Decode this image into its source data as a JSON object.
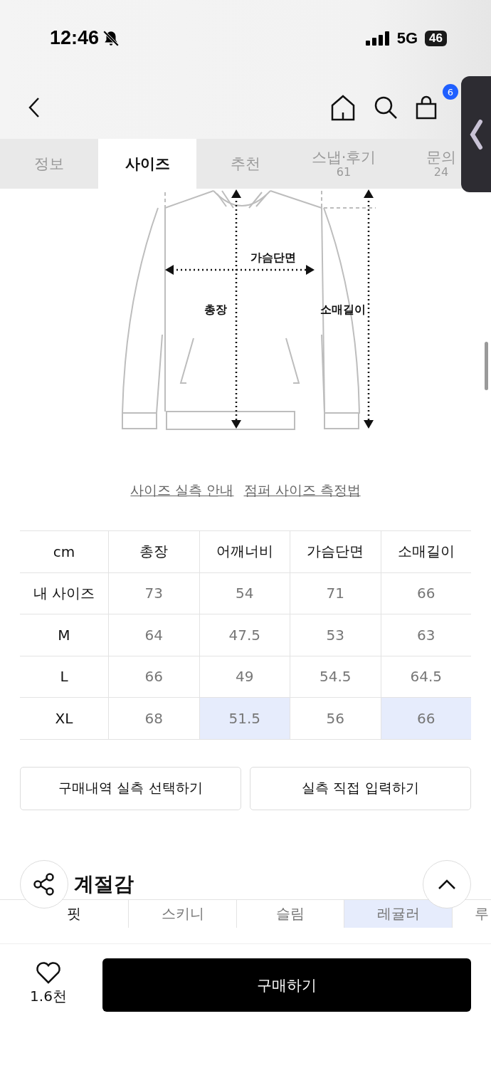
{
  "status_bar": {
    "time": "12:46",
    "network": "5G",
    "battery": "46"
  },
  "header": {
    "cart_badge": "6"
  },
  "tabs": [
    {
      "label": "정보",
      "selected": false
    },
    {
      "label": "사이즈",
      "selected": true
    },
    {
      "label": "추천",
      "selected": false
    },
    {
      "label": "스냅·후기",
      "count": "61",
      "selected": false
    },
    {
      "label": "문의",
      "count": "24",
      "selected": false
    }
  ],
  "diagram": {
    "chest_label": "가슴단면",
    "length_label": "총장",
    "sleeve_label": "소매길이"
  },
  "links": [
    "사이즈 실측 안내",
    "점퍼 사이즈 측정법"
  ],
  "size_table": {
    "columns": [
      "cm",
      "총장",
      "어깨너비",
      "가슴단면",
      "소매길이"
    ],
    "rows": [
      {
        "cells": [
          {
            "text": "내 사이즈",
            "highlighted": false
          },
          {
            "text": "73",
            "highlighted": false
          },
          {
            "text": "54",
            "highlighted": false
          },
          {
            "text": "71",
            "highlighted": false
          },
          {
            "text": "66",
            "highlighted": false
          }
        ]
      },
      {
        "cells": [
          {
            "text": "M",
            "highlighted": false
          },
          {
            "text": "64",
            "highlighted": false
          },
          {
            "text": "47.5",
            "highlighted": false
          },
          {
            "text": "53",
            "highlighted": false
          },
          {
            "text": "63",
            "highlighted": false
          }
        ]
      },
      {
        "cells": [
          {
            "text": "L",
            "highlighted": false
          },
          {
            "text": "66",
            "highlighted": false
          },
          {
            "text": "49",
            "highlighted": false
          },
          {
            "text": "54.5",
            "highlighted": false
          },
          {
            "text": "64.5",
            "highlighted": false
          }
        ]
      },
      {
        "cells": [
          {
            "text": "XL",
            "highlighted": false
          },
          {
            "text": "68",
            "highlighted": false
          },
          {
            "text": "51.5",
            "highlighted": true
          },
          {
            "text": "56",
            "highlighted": false
          },
          {
            "text": "66",
            "highlighted": true
          }
        ]
      }
    ]
  },
  "actions": [
    "구매내역 실측 선택하기",
    "실측 직접 입력하기"
  ],
  "fit_section": {
    "title": "계절감",
    "label": "핏",
    "options": [
      {
        "label": "스키니",
        "selected": false
      },
      {
        "label": "슬림",
        "selected": false
      },
      {
        "label": "레귤러",
        "selected": true
      },
      {
        "label": "루",
        "selected": false
      }
    ]
  },
  "bottom_bar": {
    "likes": "1.6천",
    "buy_button": "구매하기"
  }
}
